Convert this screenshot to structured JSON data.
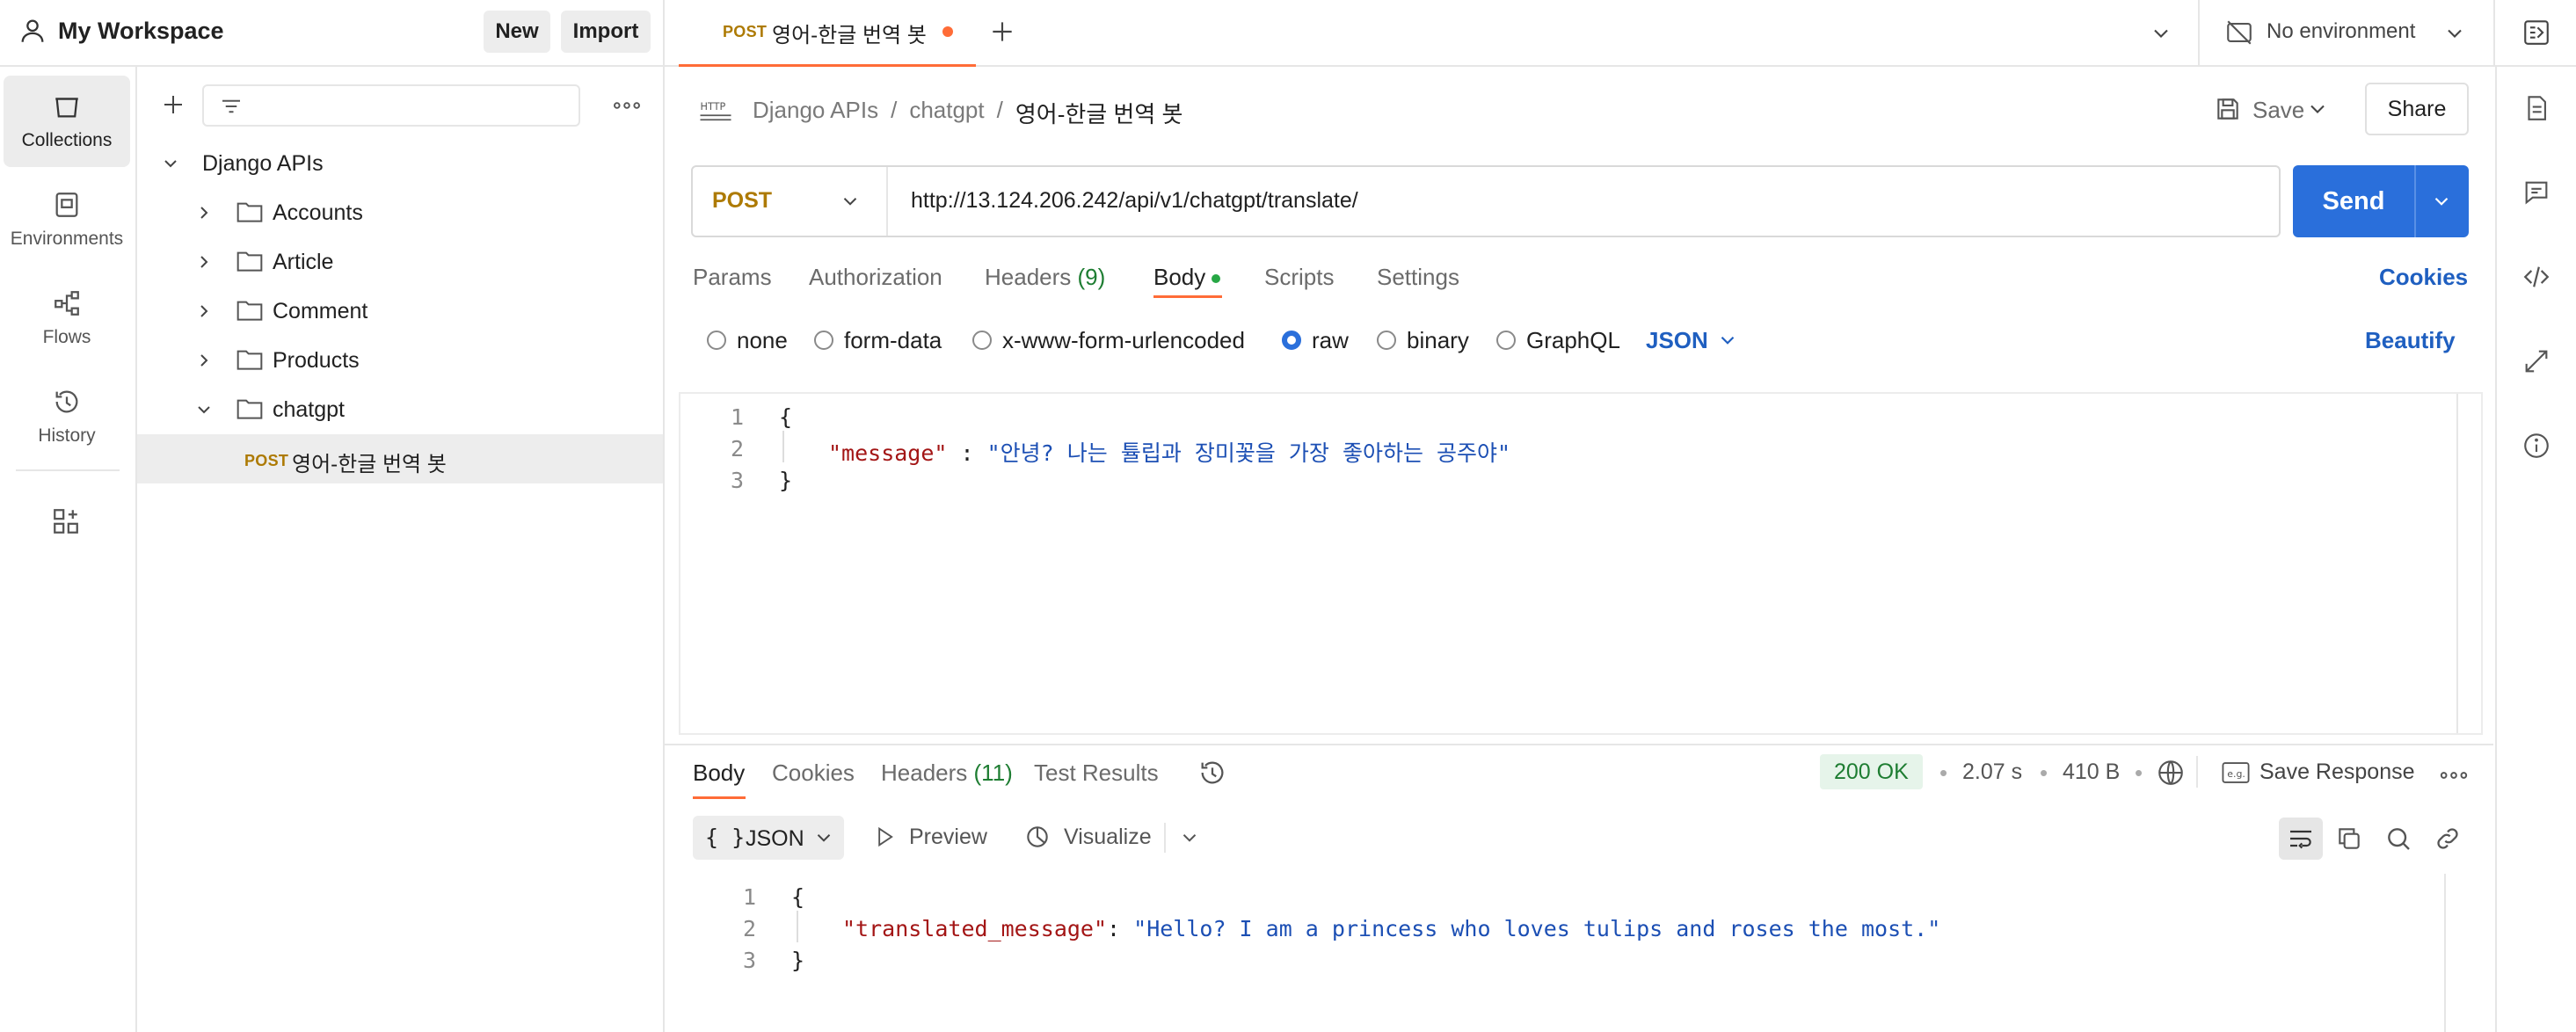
{
  "workspace": {
    "name": "My Workspace",
    "new_label": "New",
    "import_label": "Import"
  },
  "tabs": [
    {
      "method": "POST",
      "title": "영어-한글 번역 봇",
      "unsaved": true
    }
  ],
  "environment": {
    "label": "No environment"
  },
  "rail": {
    "collections": "Collections",
    "environments": "Environments",
    "flows": "Flows",
    "history": "History"
  },
  "sidebar": {
    "root": "Django APIs",
    "folders": [
      "Accounts",
      "Article",
      "Comment",
      "Products",
      "chatgpt"
    ],
    "request": {
      "method": "POST",
      "name": "영어-한글 번역 봇"
    }
  },
  "breadcrumb": {
    "collection": "Django APIs",
    "sep1": "/",
    "folder": "chatgpt",
    "sep2": "/",
    "request": "영어-한글 번역 봇"
  },
  "actions": {
    "save": "Save",
    "share": "Share"
  },
  "request": {
    "method": "POST",
    "url": "http://13.124.206.242/api/v1/chatgpt/translate/",
    "send": "Send",
    "tabs": {
      "params": "Params",
      "authorization": "Authorization",
      "headers": "Headers",
      "headers_count": "(9)",
      "body": "Body",
      "scripts": "Scripts",
      "settings": "Settings",
      "cookies": "Cookies"
    },
    "body_modes": {
      "none": "none",
      "form_data": "form-data",
      "urlencoded": "x-www-form-urlencoded",
      "raw": "raw",
      "binary": "binary",
      "graphql": "GraphQL",
      "format": "JSON",
      "beautify": "Beautify"
    },
    "lines": [
      "1",
      "2",
      "3"
    ],
    "code": {
      "open": "{",
      "key": "\"message\"",
      "colon": " : ",
      "value": "\"안녕? 나는 튤립과 장미꽃을 가장 좋아하는 공주야\"",
      "close": "}"
    }
  },
  "response": {
    "tabs": {
      "body": "Body",
      "cookies": "Cookies",
      "headers": "Headers",
      "headers_count": "(11)",
      "test_results": "Test Results"
    },
    "status": "200 OK",
    "time": "2.07 s",
    "size": "410 B",
    "dot": "•",
    "save_response": "Save Response",
    "format": "JSON",
    "preview": "Preview",
    "visualize": "Visualize",
    "lines": [
      "1",
      "2",
      "3"
    ],
    "code": {
      "open": "{",
      "key": "\"translated_message\"",
      "colon": ": ",
      "value": "\"Hello? I am a princess who loves tulips and roses the most.\"",
      "close": "}"
    }
  },
  "colors": {
    "accent": "#ff6c37",
    "send": "#2a6fdb",
    "status_ok": "#1e7d32",
    "post": "#ad7a03"
  }
}
